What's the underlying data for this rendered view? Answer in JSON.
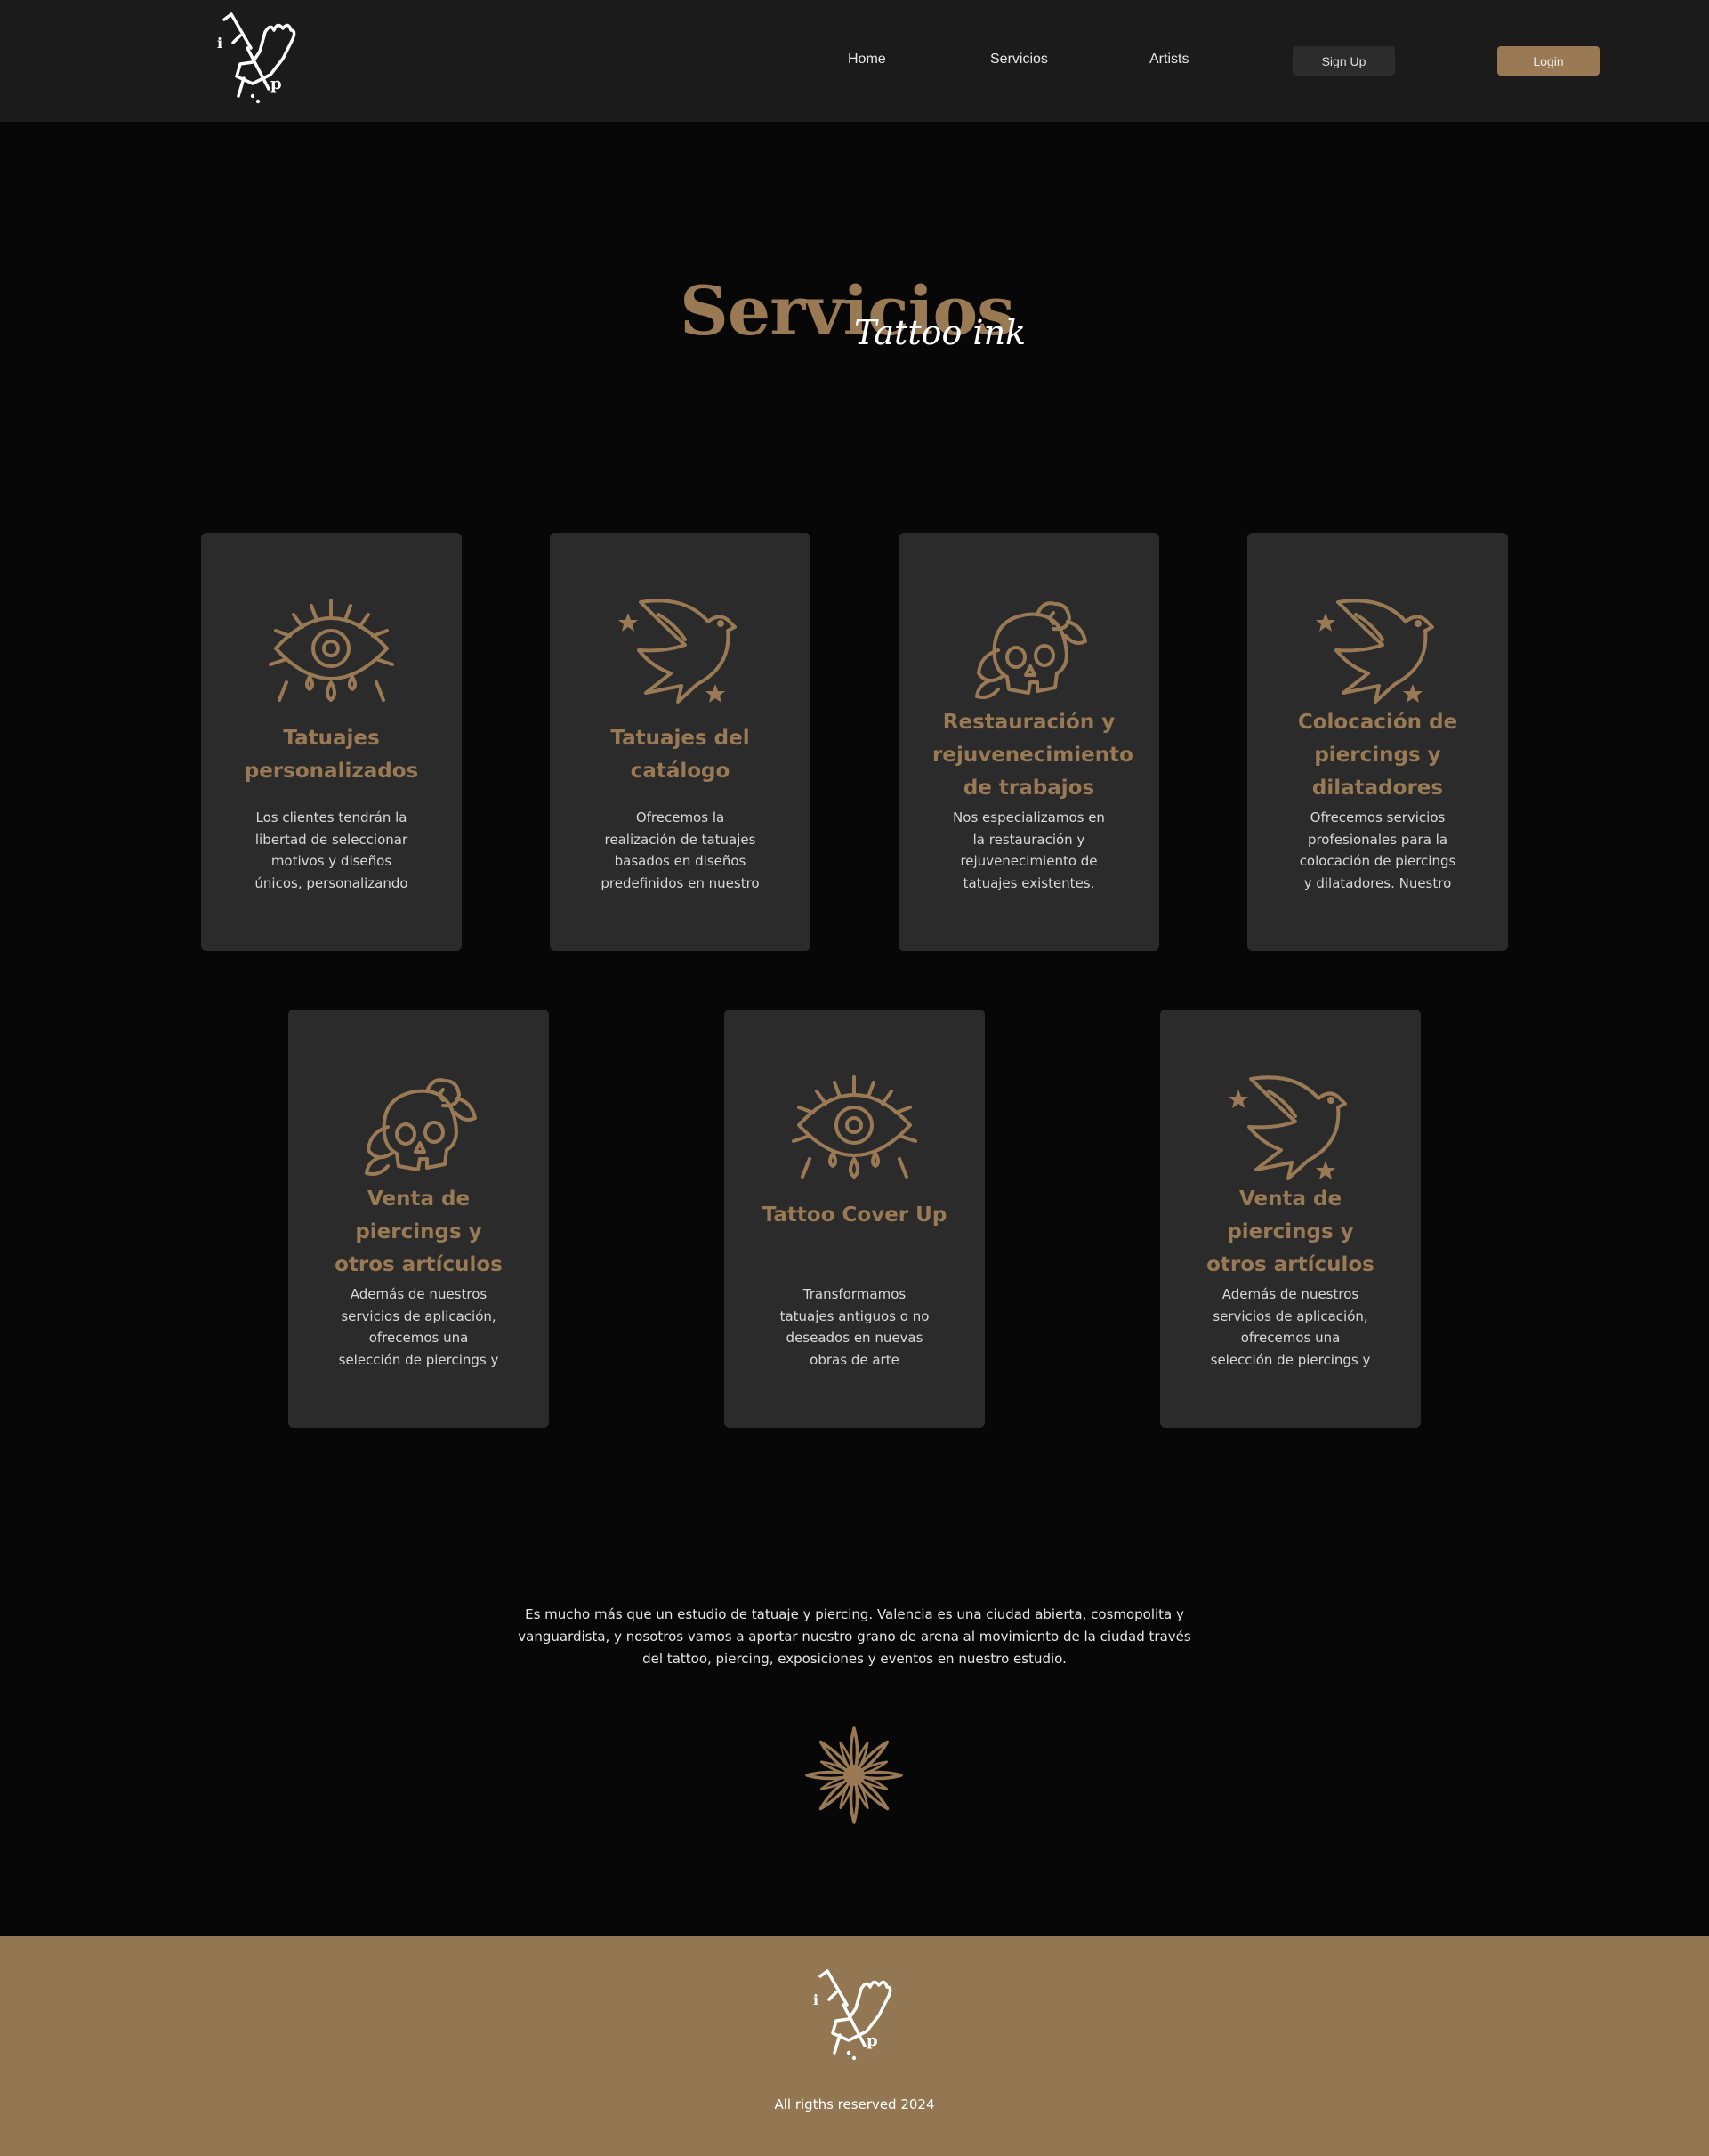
{
  "nav": {
    "home": "Home",
    "servicios": "Servicios",
    "artists": "Artists",
    "signup": "Sign Up",
    "login": "Login"
  },
  "hero": {
    "title": "Servicios",
    "subtitle": "Tattoo ink"
  },
  "services": [
    {
      "icon": "eye-icon",
      "title": "Tatuajes personalizados",
      "text": "Los clientes tendrán la libertad de seleccionar motivos y diseños únicos, personalizando"
    },
    {
      "icon": "swallow-icon",
      "title": "Tatuajes del catálogo",
      "text": "Ofrecemos la realización de tatuajes basados en diseños predefinidos en nuestro catálogo. Los"
    },
    {
      "icon": "skull-icon",
      "title": "Restauración y rejuvenecimiento de trabajos",
      "text": "Nos especializamos en la restauración y rejuvenecimiento de tatuajes existentes."
    },
    {
      "icon": "swallow-icon",
      "title": "Colocación de piercings y dilatadores",
      "text": "Ofrecemos servicios profesionales para la colocación de piercings y dilatadores. Nuestro"
    },
    {
      "icon": "skull-icon",
      "title": "Venta de piercings y otros artículos",
      "text": "Además de nuestros servicios de aplicación, ofrecemos una selección de piercings y"
    },
    {
      "icon": "eye-icon",
      "title": "Tattoo Cover Up",
      "text": "Transformamos tatuajes antiguos o no deseados en nuevas obras de arte"
    },
    {
      "icon": "swallow-icon",
      "title": "Venta de piercings y otros artículos",
      "text": "Además de nuestros servicios de aplicación, ofrecemos una selección de piercings y"
    }
  ],
  "about": {
    "text": "Es mucho más que un estudio de tatuaje y piercing. Valencia es una ciudad abierta, cosmopolita y vanguardista, y nosotros vamos a aportar nuestro grano de arena al movimiento de la ciudad través del tattoo, piercing, exposiciones y eventos en nuestro estudio."
  },
  "footer": {
    "copyright": "All rigths reserved 2024"
  },
  "colors": {
    "accent": "#9a7a55",
    "footer_bg": "#937753",
    "card_bg": "#2b2b2b",
    "header_bg": "#1b1b1b",
    "page_bg": "#070707"
  }
}
